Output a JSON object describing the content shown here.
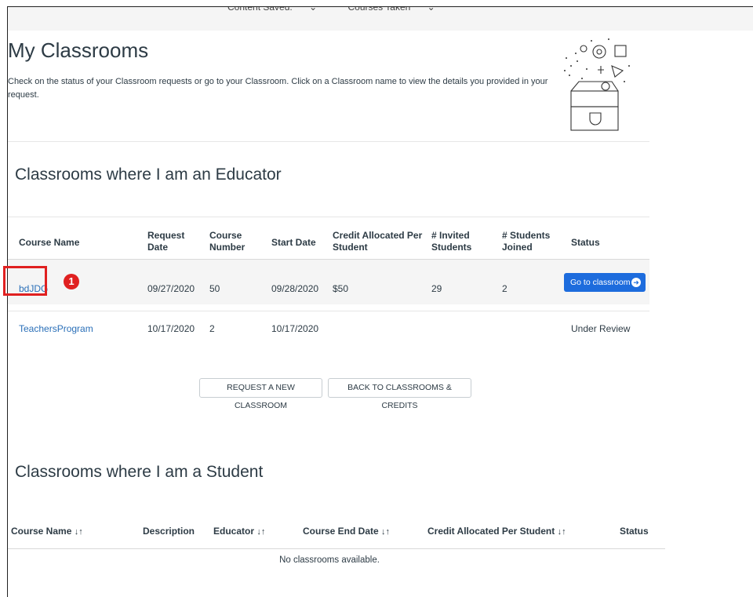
{
  "topbar": {
    "content_saved": "Content Saved:",
    "courses_taken": "Courses Taken"
  },
  "page": {
    "title": "My Classrooms",
    "intro": "Check on the status of your Classroom requests or go to your Classroom. Click on a Classroom name to view the details you provided in your request."
  },
  "educator": {
    "heading": "Classrooms where I am an Educator",
    "headers": {
      "course_name": "Course Name",
      "request_date": "Request Date",
      "course_number": "Course Number",
      "start_date": "Start Date",
      "credit": "Credit Allocated Per Student",
      "invited": "# Invited Students",
      "joined": "# Students Joined",
      "status": "Status"
    },
    "rows": [
      {
        "course_name": "bdJDG",
        "request_date": "09/27/2020",
        "course_number": "50",
        "start_date": "09/28/2020",
        "credit": "$50",
        "invited": "29",
        "joined": "2",
        "status": "Go to classroom"
      },
      {
        "course_name": "TeachersProgram",
        "request_date": "10/17/2020",
        "course_number": "2",
        "start_date": "10/17/2020",
        "credit": "",
        "invited": "",
        "joined": "",
        "status": "Under Review"
      }
    ],
    "annotation": "1"
  },
  "actions": {
    "request_new": "REQUEST A NEW CLASSROOM",
    "back": "BACK TO CLASSROOMS & CREDITS"
  },
  "student": {
    "heading": "Classrooms where I am a Student",
    "headers": {
      "course_name": "Course Name",
      "description": "Description",
      "educator": "Educator",
      "end_date": "Course End Date",
      "credit": "Credit Allocated Per Student",
      "status": "Status"
    },
    "empty": "No classrooms available."
  },
  "colors": {
    "link": "#2a6fb8",
    "primary_button": "#1d6cdd",
    "annotation": "#e02020"
  }
}
